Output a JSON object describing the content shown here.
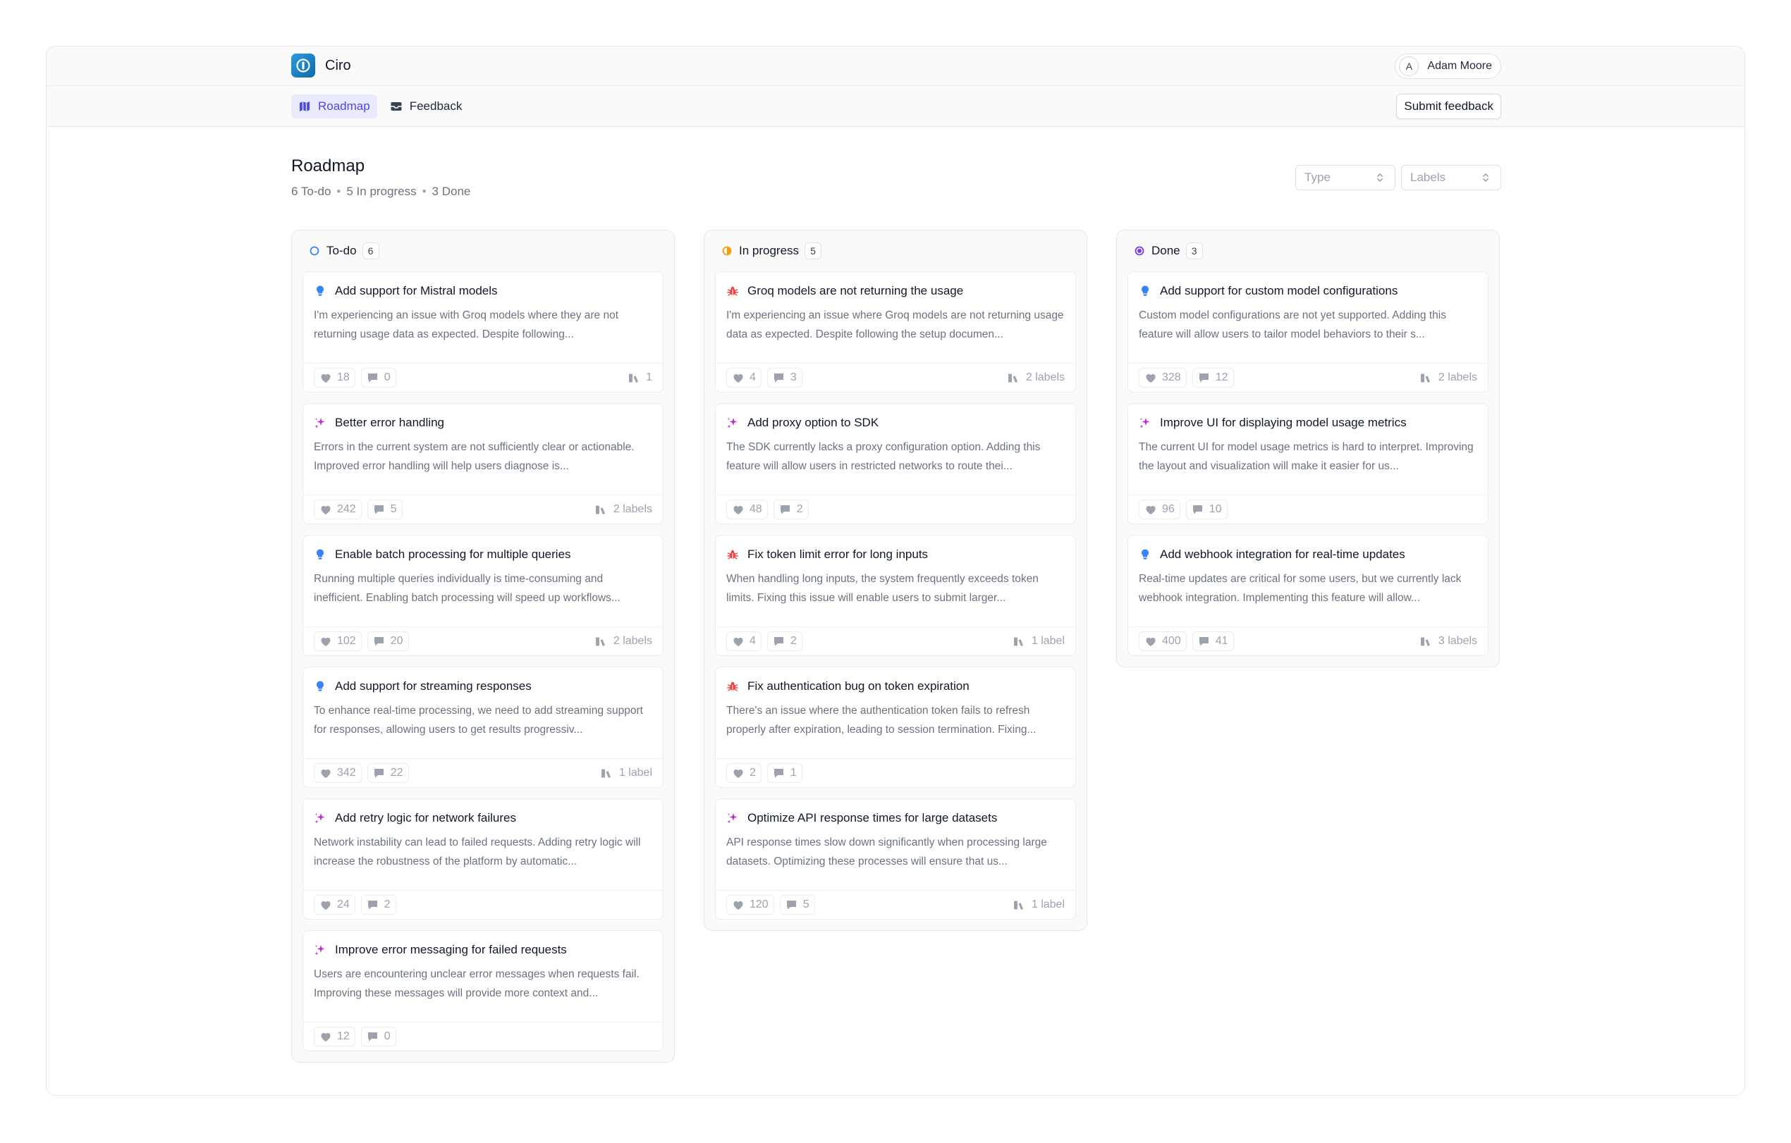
{
  "app": {
    "name": "Ciro",
    "brand_color": "#1f8fd6"
  },
  "user": {
    "initial": "A",
    "name": "Adam Moore"
  },
  "nav": {
    "tabs": [
      {
        "label": "Roadmap",
        "icon": "map-icon",
        "active": true
      },
      {
        "label": "Feedback",
        "icon": "inbox-icon",
        "active": false
      }
    ],
    "submit_label": "Submit feedback"
  },
  "page": {
    "title": "Roadmap",
    "summary": {
      "todo": "6 To-do",
      "in_progress": "5 In progress",
      "done": "3 Done"
    }
  },
  "filters": {
    "type": "Type",
    "labels": "Labels"
  },
  "colors": {
    "accent": "#4f46e5",
    "todo": "#3b82f6",
    "in_progress": "#f59e0b",
    "done": "#7c3aed",
    "bug": "#ef4444",
    "idea": "#3b82f6",
    "improvement": "#c026d3"
  },
  "columns": [
    {
      "title": "To-do",
      "count": "6",
      "status_icon": "circle-outline-icon",
      "cards": [
        {
          "type": "idea",
          "title": "Add support for Mistral models",
          "desc": "I'm experiencing an issue with Groq models where they are not returning usage data as expected. Despite following...",
          "likes": "18",
          "comments": "0",
          "labels": "1"
        },
        {
          "type": "improvement",
          "title": "Better error handling",
          "desc": "Errors in the current system are not sufficiently clear or actionable. Improved error handling will help users diagnose is...",
          "likes": "242",
          "comments": "5",
          "labels": "2 labels"
        },
        {
          "type": "idea",
          "title": "Enable batch processing for multiple queries",
          "desc": "Running multiple queries individually is time-consuming and inefficient. Enabling batch processing will speed up workflows...",
          "likes": "102",
          "comments": "20",
          "labels": "2 labels"
        },
        {
          "type": "idea",
          "title": "Add support for streaming responses",
          "desc": "To enhance real-time processing, we need to add streaming support for responses, allowing users to get results progressiv...",
          "likes": "342",
          "comments": "22",
          "labels": "1 label"
        },
        {
          "type": "improvement",
          "title": "Add retry logic for network failures",
          "desc": "Network instability can lead to failed requests. Adding retry logic will increase the robustness of the platform by automatic...",
          "likes": "24",
          "comments": "2",
          "labels": ""
        },
        {
          "type": "improvement",
          "title": "Improve error messaging for failed requests",
          "desc": "Users are encountering unclear error messages when requests fail. Improving these messages will provide more context and...",
          "likes": "12",
          "comments": "0",
          "labels": ""
        }
      ]
    },
    {
      "title": "In progress",
      "count": "5",
      "status_icon": "half-circle-icon",
      "cards": [
        {
          "type": "bug",
          "title": "Groq models are not returning the usage",
          "desc": "I'm experiencing an issue where Groq models are not returning usage data as expected. Despite following the setup documen...",
          "likes": "4",
          "comments": "3",
          "labels": "2 labels"
        },
        {
          "type": "improvement",
          "title": "Add proxy option to SDK",
          "desc": "The SDK currently lacks a proxy configuration option. Adding this feature will allow users in restricted networks to route thei...",
          "likes": "48",
          "comments": "2",
          "labels": ""
        },
        {
          "type": "bug",
          "title": "Fix token limit error for long inputs",
          "desc": "When handling long inputs, the system frequently exceeds token limits. Fixing this issue will enable users to submit larger...",
          "likes": "4",
          "comments": "2",
          "labels": "1 label"
        },
        {
          "type": "bug",
          "title": "Fix authentication bug on token expiration",
          "desc": "There's an issue where the authentication token fails to refresh properly after expiration, leading to session termination. Fixing...",
          "likes": "2",
          "comments": "1",
          "labels": ""
        },
        {
          "type": "improvement",
          "title": "Optimize API response times for large datasets",
          "desc": "API response times slow down significantly when processing large datasets. Optimizing these processes will ensure that us...",
          "likes": "120",
          "comments": "5",
          "labels": "1 label"
        }
      ]
    },
    {
      "title": "Done",
      "count": "3",
      "status_icon": "filled-circle-icon",
      "cards": [
        {
          "type": "idea",
          "title": "Add support for custom model configurations",
          "desc": "Custom model configurations are not yet supported. Adding this feature will allow users to tailor model behaviors to their s...",
          "likes": "328",
          "comments": "12",
          "labels": "2 labels"
        },
        {
          "type": "improvement",
          "title": "Improve UI for displaying model usage metrics",
          "desc": "The current UI for model usage metrics is hard to interpret. Improving the layout and visualization will make it easier for us...",
          "likes": "96",
          "comments": "10",
          "labels": ""
        },
        {
          "type": "idea",
          "title": "Add webhook integration for real-time updates",
          "desc": "Real-time updates are critical for some users, but we currently lack webhook integration. Implementing this feature will allow...",
          "likes": "400",
          "comments": "41",
          "labels": "3 labels"
        }
      ]
    }
  ]
}
